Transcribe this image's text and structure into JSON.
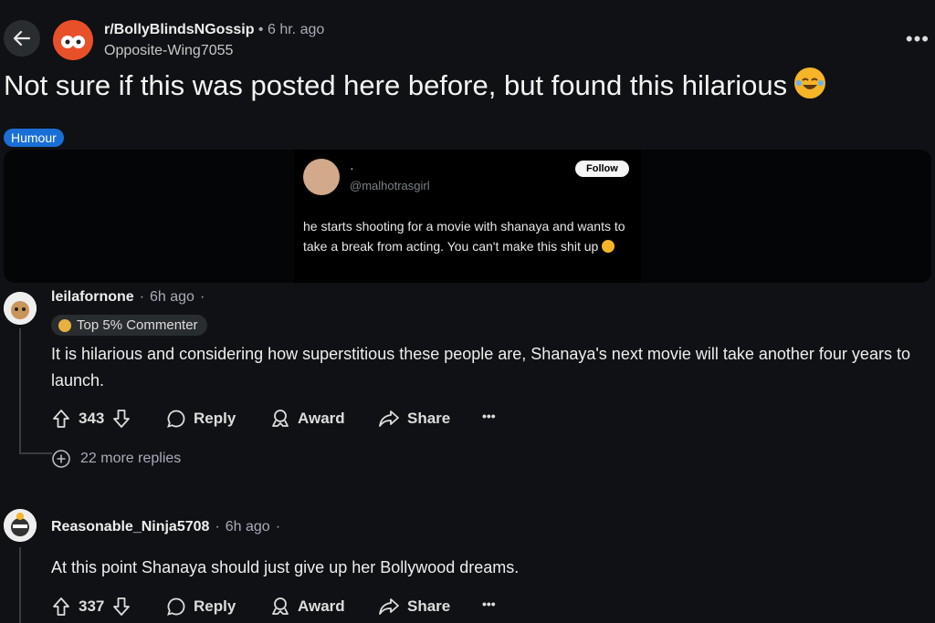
{
  "header": {
    "subreddit": "r/BollyBlindsNGossip",
    "separator": "•",
    "time": "6 hr. ago",
    "author": "Opposite-Wing7055",
    "more_label": "•••"
  },
  "post": {
    "title": "Not sure if this was posted here before, but found this hilarious",
    "flair": "Humour"
  },
  "tweet": {
    "name": "·",
    "handle": "@malhotrasgirl",
    "follow_label": "Follow",
    "text": "he starts shooting for a movie with shanaya and wants to take a break from acting. You can't make this shit up"
  },
  "comments": [
    {
      "user": "leilafornone",
      "time": "6h ago",
      "badge": "Top 5% Commenter",
      "body": "It is hilarious and considering how superstitious these people are, Shanaya's next movie will take another four years to launch.",
      "votes": "343",
      "reply": "Reply",
      "award": "Award",
      "share": "Share",
      "more": "•••",
      "more_replies": "22 more replies"
    },
    {
      "user": "Reasonable_Ninja5708",
      "time": "6h ago",
      "body": "At this point Shanaya should just give up her Bollywood dreams.",
      "votes": "337",
      "reply": "Reply",
      "award": "Award",
      "share": "Share",
      "more": "•••"
    }
  ],
  "colors": {
    "background": "#0f1114",
    "flair": "#1a6fd6",
    "emoji": "#f6b428"
  }
}
